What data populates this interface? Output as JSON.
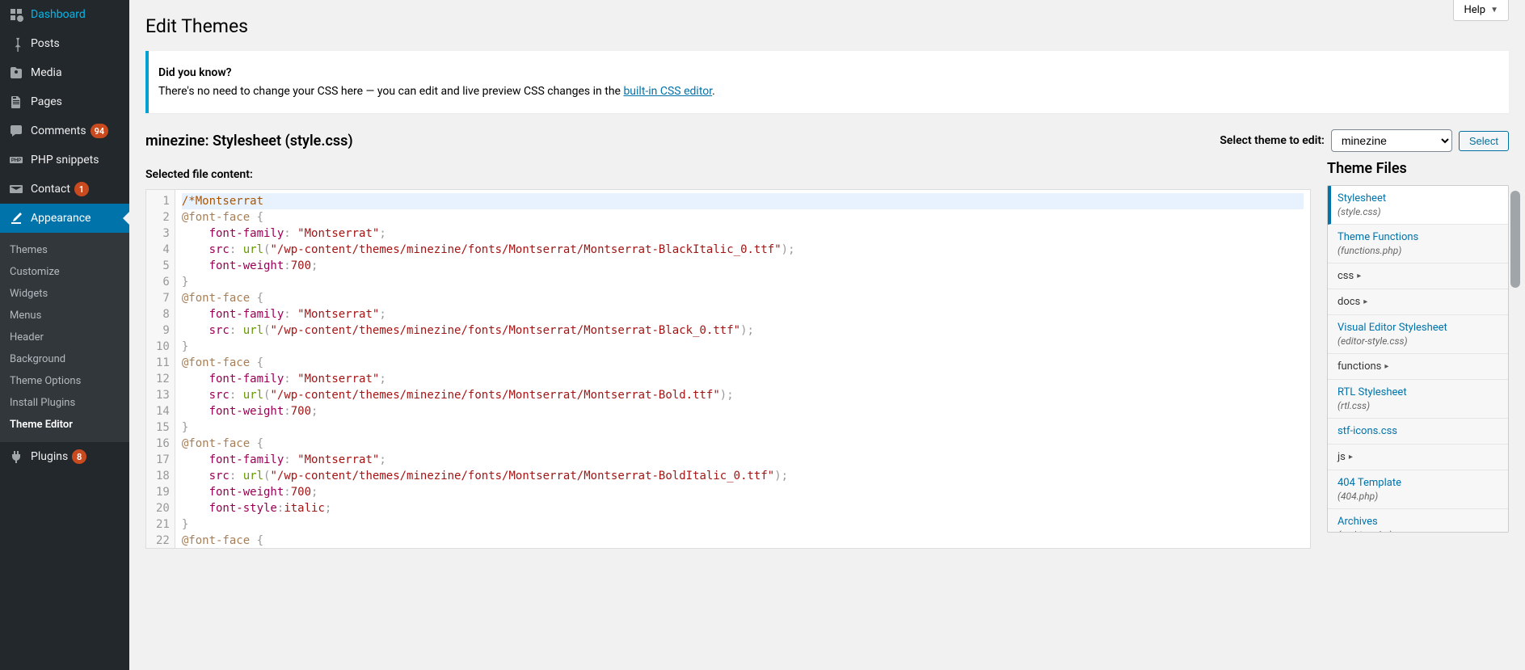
{
  "sidebar": {
    "items": [
      {
        "label": "Dashboard",
        "icon": "dashboard"
      },
      {
        "label": "Posts",
        "icon": "pin"
      },
      {
        "label": "Media",
        "icon": "media"
      },
      {
        "label": "Pages",
        "icon": "pages"
      },
      {
        "label": "Comments",
        "icon": "comments",
        "badge": "94"
      },
      {
        "label": "PHP snippets",
        "icon": "php"
      },
      {
        "label": "Contact",
        "icon": "contact",
        "badge": "1"
      },
      {
        "label": "Appearance",
        "icon": "appearance",
        "active": true
      },
      {
        "label": "Plugins",
        "icon": "plugins",
        "badge": "8"
      }
    ],
    "submenu": [
      {
        "label": "Themes"
      },
      {
        "label": "Customize"
      },
      {
        "label": "Widgets"
      },
      {
        "label": "Menus"
      },
      {
        "label": "Header"
      },
      {
        "label": "Background"
      },
      {
        "label": "Theme Options"
      },
      {
        "label": "Install Plugins"
      },
      {
        "label": "Theme Editor",
        "current": true
      }
    ]
  },
  "help_label": "Help",
  "page_title": "Edit Themes",
  "notice": {
    "heading": "Did you know?",
    "text_before": "There's no need to change your CSS here — you can edit and live preview CSS changes in the ",
    "link_text": "built-in CSS editor",
    "text_after": "."
  },
  "file_heading": "minezine: Stylesheet (style.css)",
  "select_theme_label": "Select theme to edit:",
  "selected_theme": "minezine",
  "select_button": "Select",
  "content_label": "Selected file content:",
  "code_lines": [
    "/*Montserrat",
    "@font-face {",
    "    font-family: \"Montserrat\";",
    "    src: url(\"/wp-content/themes/minezine/fonts/Montserrat/Montserrat-BlackItalic_0.ttf\");",
    "    font-weight:700;",
    "}",
    "@font-face {",
    "    font-family: \"Montserrat\";",
    "    src: url(\"/wp-content/themes/minezine/fonts/Montserrat/Montserrat-Black_0.ttf\");",
    "}",
    "@font-face {",
    "    font-family: \"Montserrat\";",
    "    src: url(\"/wp-content/themes/minezine/fonts/Montserrat/Montserrat-Bold.ttf\");",
    "    font-weight:700;",
    "}",
    "@font-face {",
    "    font-family: \"Montserrat\";",
    "    src: url(\"/wp-content/themes/minezine/fonts/Montserrat/Montserrat-BoldItalic_0.ttf\");",
    "    font-weight:700;",
    "    font-style:italic;",
    "}",
    "@font-face {"
  ],
  "files_heading": "Theme Files",
  "files": [
    {
      "label": "Stylesheet",
      "meta": "(style.css)",
      "active": true
    },
    {
      "label": "Theme Functions",
      "meta": "(functions.php)"
    },
    {
      "label": "css",
      "folder": true
    },
    {
      "label": "docs",
      "folder": true
    },
    {
      "label": "Visual Editor Stylesheet",
      "meta": "(editor-style.css)"
    },
    {
      "label": "functions",
      "folder": true
    },
    {
      "label": "RTL Stylesheet",
      "meta": "(rtl.css)"
    },
    {
      "label": "stf-icons.css"
    },
    {
      "label": "js",
      "folder": true
    },
    {
      "label": "404 Template",
      "meta": "(404.php)"
    },
    {
      "label": "Archives",
      "meta": "(archive.php)"
    }
  ]
}
